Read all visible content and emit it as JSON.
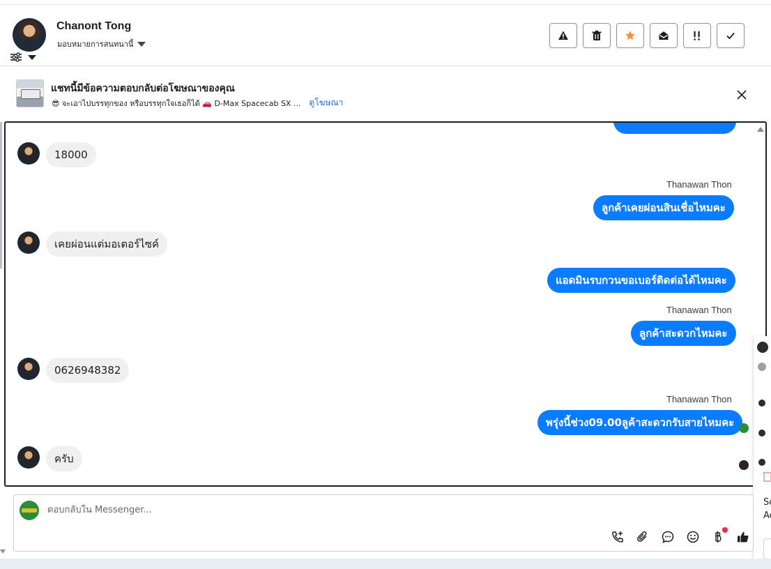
{
  "header": {
    "user_name": "Chanont Tong",
    "assign_label": "มอบหมายการสนทนานี้",
    "actions": [
      {
        "icon": "warning-icon"
      },
      {
        "icon": "trash-icon"
      },
      {
        "icon": "star-icon"
      },
      {
        "icon": "mark-unread-icon"
      },
      {
        "icon": "follow-up-icon"
      },
      {
        "icon": "check-icon"
      }
    ]
  },
  "ad_banner": {
    "title": "แชทนี้มีข้อความตอบกลับต่อโฆษณาของคุณ",
    "text": "😎 จะเอาไปบรรทุกของ หรือบรรทุกใจเธอก็ได้ 🚗 D-Max Spacecab SX ...",
    "link_label": "ดูโฆษณา"
  },
  "messages": [
    {
      "dir": "in",
      "text": "18000"
    },
    {
      "dir": "out",
      "sender": "Thanawan Thon",
      "text": "ลูกค้าเคยผ่อนสินเชื่อไหมคะ"
    },
    {
      "dir": "in",
      "text": "เคยผ่อนแต่มอเตอร์ไซค์"
    },
    {
      "dir": "out",
      "text": "แอดมินรบกวนขอเบอร์ติดต่อได้ไหมคะ"
    },
    {
      "dir": "out",
      "sender": "Thanawan Thon",
      "text": "ลูกค้าสะดวกไหมคะ"
    },
    {
      "dir": "in",
      "text": "0626948382"
    },
    {
      "dir": "out",
      "sender": "Thanawan Thon",
      "text": "พรุ่งนี้ช่วง09.00ลูค้าสะดวกรับสายไหมคะ"
    },
    {
      "dir": "in",
      "text": "ครับ"
    }
  ],
  "side_strip": {
    "text_1": "Sc",
    "text_2": "Ac"
  },
  "composer": {
    "placeholder": "ตอบกลับใน Messenger..."
  },
  "colors": {
    "outgoing_bubble": "#0a7cff",
    "incoming_bubble": "#f0f0f0",
    "link": "#216fdb",
    "star": "#f7923b"
  }
}
